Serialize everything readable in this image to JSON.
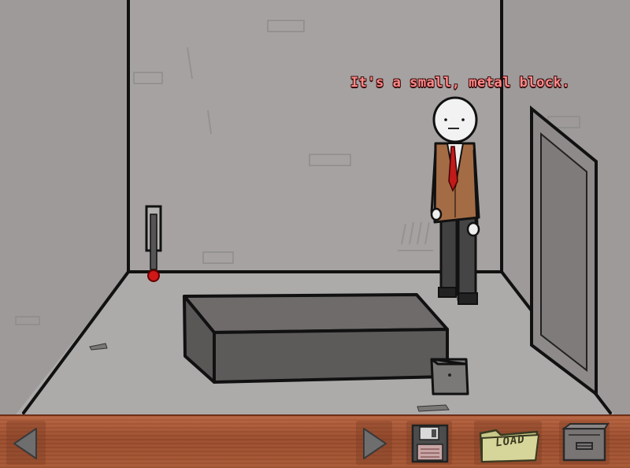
{
  "dialogue": {
    "text": "It's a small, metal block.",
    "color": "#ff8a8a"
  },
  "scene": {
    "objects": [
      "wall-lever",
      "large-metal-slab",
      "small-metal-block",
      "door",
      "character"
    ]
  },
  "toolbar": {
    "back_icon": "left-arrow-icon",
    "forward_icon": "right-arrow-icon",
    "save_icon": "floppy-disk-icon",
    "load_label": "LOAD",
    "load_icon": "folder-icon",
    "menu_icon": "crate-icon"
  },
  "colors": {
    "wall": "#9d9a99",
    "floor": "#aaa8a7",
    "toolbar": "#a85834",
    "lever_knob": "#d01818",
    "tie": "#c01a1a",
    "jacket": "#a46c45"
  }
}
